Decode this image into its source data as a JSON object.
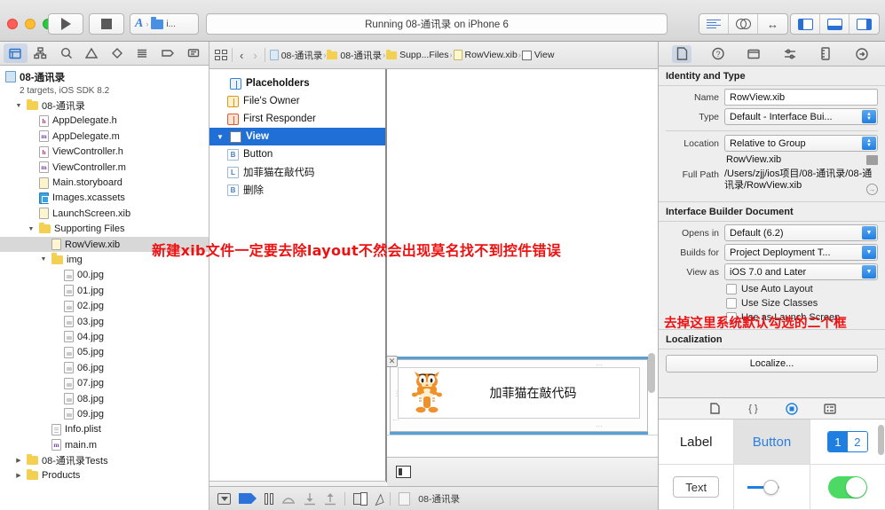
{
  "window": {
    "status_text": "Running 08-通讯录 on iPhone 6",
    "scheme_label": "i..."
  },
  "toolbar": {
    "run_button": "run-button",
    "stop_button": "stop-button",
    "editor_segments": [
      "standard-editor",
      "assistant-editor",
      "version-editor"
    ],
    "view_segments": [
      "hide-navigator",
      "hide-debug-area",
      "hide-utilities"
    ]
  },
  "navigator": {
    "tabs": [
      "project-navigator",
      "symbol-navigator",
      "find-navigator",
      "issue-navigator",
      "test-navigator",
      "debug-navigator",
      "breakpoint-navigator",
      "report-navigator"
    ],
    "project": {
      "title": "08-通讯录",
      "subtitle": "2 targets, iOS SDK 8.2"
    },
    "tree": [
      {
        "label": "08-通讯录",
        "kind": "folder",
        "indent": 1,
        "twisty": "open"
      },
      {
        "label": "AppDelegate.h",
        "kind": "h",
        "indent": 2
      },
      {
        "label": "AppDelegate.m",
        "kind": "m",
        "indent": 2
      },
      {
        "label": "ViewController.h",
        "kind": "h",
        "indent": 2
      },
      {
        "label": "ViewController.m",
        "kind": "m",
        "indent": 2
      },
      {
        "label": "Main.storyboard",
        "kind": "sb",
        "indent": 2
      },
      {
        "label": "Images.xcassets",
        "kind": "xcassets",
        "indent": 2
      },
      {
        "label": "LaunchScreen.xib",
        "kind": "xib",
        "indent": 2
      },
      {
        "label": "Supporting Files",
        "kind": "folder",
        "indent": 2,
        "twisty": "open"
      },
      {
        "label": "RowView.xib",
        "kind": "xib2",
        "indent": 3,
        "selected": true
      },
      {
        "label": "img",
        "kind": "folder",
        "indent": 3,
        "twisty": "open"
      },
      {
        "label": "00.jpg",
        "kind": "img",
        "indent": 4
      },
      {
        "label": "01.jpg",
        "kind": "img",
        "indent": 4
      },
      {
        "label": "02.jpg",
        "kind": "img",
        "indent": 4
      },
      {
        "label": "03.jpg",
        "kind": "img",
        "indent": 4
      },
      {
        "label": "04.jpg",
        "kind": "img",
        "indent": 4
      },
      {
        "label": "05.jpg",
        "kind": "img",
        "indent": 4
      },
      {
        "label": "06.jpg",
        "kind": "img",
        "indent": 4
      },
      {
        "label": "07.jpg",
        "kind": "img",
        "indent": 4
      },
      {
        "label": "08.jpg",
        "kind": "img",
        "indent": 4
      },
      {
        "label": "09.jpg",
        "kind": "img",
        "indent": 4
      },
      {
        "label": "Info.plist",
        "kind": "plist",
        "indent": 3
      },
      {
        "label": "main.m",
        "kind": "m",
        "indent": 3
      },
      {
        "label": "08-通讯录Tests",
        "kind": "folder",
        "indent": 1,
        "twisty": "closed"
      },
      {
        "label": "Products",
        "kind": "folder",
        "indent": 1,
        "twisty": "closed"
      }
    ]
  },
  "jumpbar": {
    "crumbs": [
      {
        "label": "08-通讯录",
        "icon": "project-file-icon"
      },
      {
        "label": "08-通讯录",
        "icon": "folder-icon"
      },
      {
        "label": "Supp...Files",
        "icon": "folder-icon"
      },
      {
        "label": "RowView.xib",
        "icon": "xib-file-icon"
      },
      {
        "label": "View",
        "icon": "view-icon"
      }
    ]
  },
  "outline": {
    "rows": [
      {
        "label": "Placeholders",
        "icon": "cube-icon",
        "indent": 0,
        "bold": true
      },
      {
        "label": "File's Owner",
        "icon": "owner-cube-icon",
        "indent": 1
      },
      {
        "label": "First Responder",
        "icon": "responder-cube-icon",
        "indent": 1
      },
      {
        "label": "View",
        "icon": "view-icon",
        "indent": 0,
        "selected": true,
        "twisty": "open"
      },
      {
        "label": "Button",
        "icon": "B",
        "indent": 1
      },
      {
        "label": "加菲猫在敲代码",
        "icon": "L",
        "indent": 1
      },
      {
        "label": "删除",
        "icon": "B",
        "indent": 1
      }
    ],
    "filter_placeholder": ""
  },
  "canvas": {
    "cell_label": "加菲猫在敲代码",
    "image_name": "garfield-image"
  },
  "annotations": {
    "layout": "新建xib文件一定要去除layout不然会出现莫名找不到控件错误",
    "checkbox": "去掉这里系统默认勾选的二个框"
  },
  "inspector": {
    "tabs": [
      "file-inspector",
      "quick-help-inspector",
      "identity-inspector",
      "attributes-inspector",
      "size-inspector",
      "connections-inspector"
    ],
    "identity_and_type": {
      "header": "Identity and Type",
      "name_label": "Name",
      "name_value": "RowView.xib",
      "type_label": "Type",
      "type_value": "Default - Interface Bui...",
      "location_label": "Location",
      "location_value": "Relative to Group",
      "location_file": "RowView.xib",
      "full_path_label": "Full Path",
      "full_path_value": "/Users/zjj/ios项目/08-通讯录/08-通讯录/RowView.xib"
    },
    "ib_document": {
      "header": "Interface Builder Document",
      "opens_in_label": "Opens in",
      "opens_in_value": "Default (6.2)",
      "builds_for_label": "Builds for",
      "builds_for_value": "Project Deployment T...",
      "view_as_label": "View as",
      "view_as_value": "iOS 7.0 and Later",
      "checkboxes": [
        {
          "label": "Use Auto Layout",
          "checked": false
        },
        {
          "label": "Use Size Classes",
          "checked": false
        },
        {
          "label": "Use as Launch Screen",
          "checked": false
        }
      ]
    },
    "localization": {
      "header": "Localization",
      "button": "Localize..."
    }
  },
  "library": {
    "tabs": [
      "file-template-library",
      "code-snippet-library",
      "object-library",
      "media-library"
    ],
    "items": [
      {
        "label": "Label",
        "kind": "label"
      },
      {
        "label": "Button",
        "kind": "button",
        "selected": true
      },
      {
        "label": "",
        "kind": "segmented",
        "seg_a": "1",
        "seg_b": "2"
      },
      {
        "label": "Text",
        "kind": "textfield"
      },
      {
        "label": "",
        "kind": "slider"
      },
      {
        "label": "",
        "kind": "switch"
      }
    ]
  },
  "debugbar": {
    "scheme_label": "08-通讯录",
    "buttons": [
      "hide-debug-area",
      "activate-breakpoints",
      "pause",
      "step-over",
      "step-into",
      "step-out",
      "view-hierarchy",
      "simulate-location"
    ]
  },
  "colors": {
    "accent": "#1f7fe0",
    "selection": "#1f6fd6",
    "annotation_red": "#ee1111",
    "folder_yellow": "#f3cf52"
  }
}
